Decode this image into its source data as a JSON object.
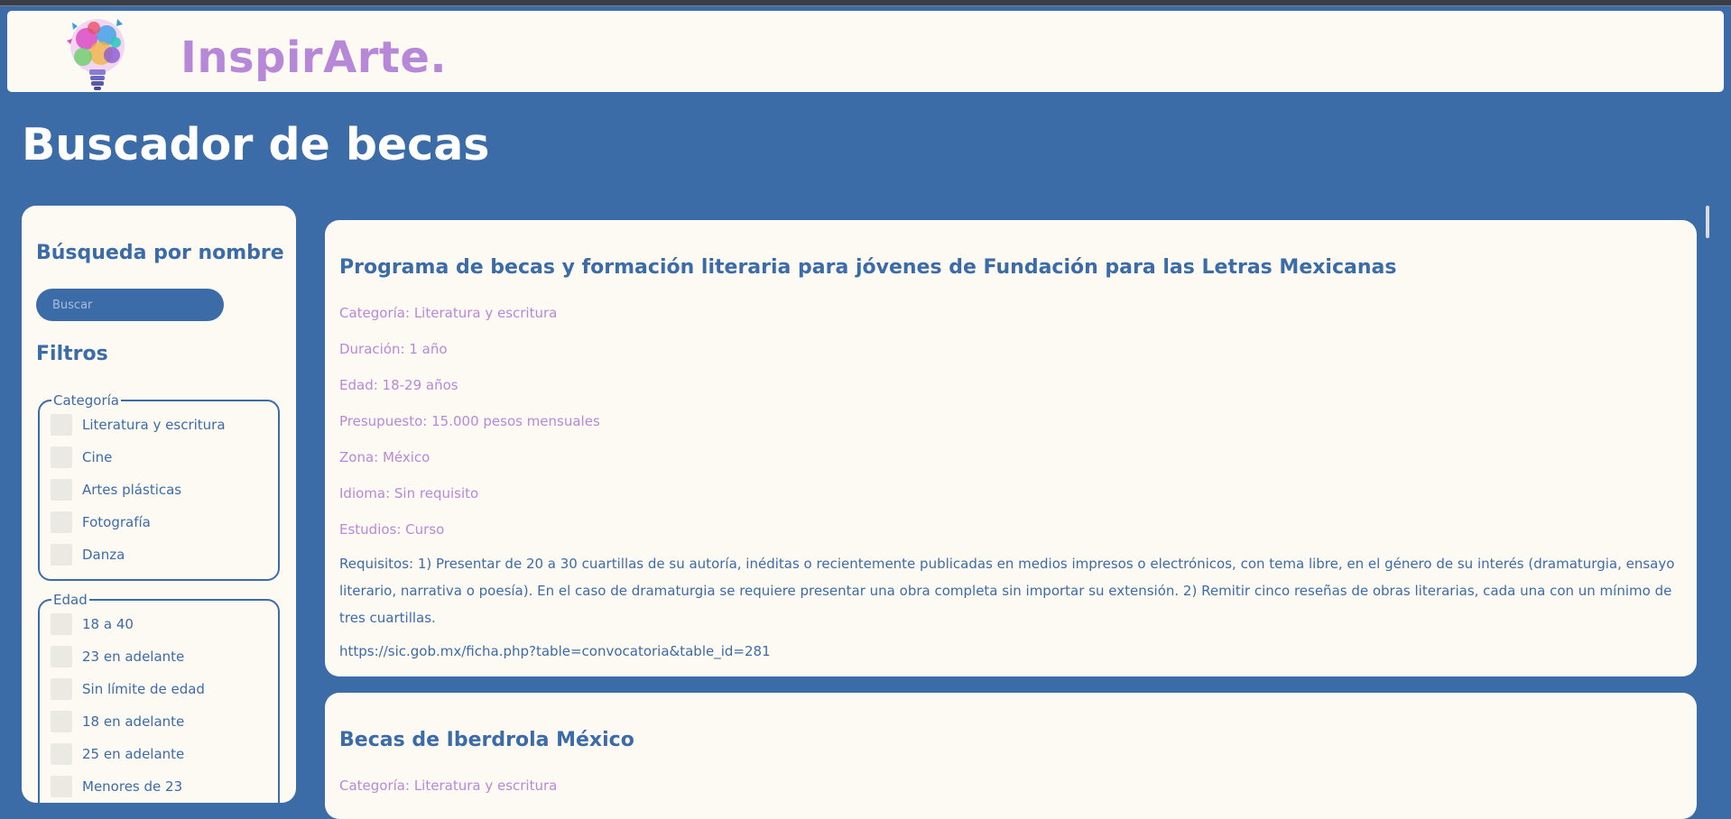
{
  "header": {
    "brand": "InspirArte."
  },
  "page": {
    "title": "Buscador de becas"
  },
  "sidebar": {
    "search_heading": "Búsqueda por nombre",
    "search_placeholder": "Buscar",
    "search_value": "",
    "filters_heading": "Filtros",
    "filters": [
      {
        "legend": "Categoría",
        "options": [
          "Literatura y escritura",
          "Cine",
          "Artes plásticas",
          "Fotografía",
          "Danza"
        ]
      },
      {
        "legend": "Edad",
        "options": [
          "18 a 40",
          "23 en adelante",
          "Sin límite de edad",
          "18 en adelante",
          "25 en adelante",
          "Menores de 23"
        ]
      }
    ]
  },
  "results": [
    {
      "title": "Programa de becas y formación literaria para jóvenes de Fundación para las Letras Mexicanas",
      "categoria": "Categoría: Literatura y escritura",
      "duracion": "Duración: 1 año",
      "edad": "Edad: 18-29 años",
      "presupuesto": "Presupuesto: 15.000 pesos mensuales",
      "zona": "Zona: México",
      "idioma": "Idioma: Sin requisito",
      "estudios": "Estudios: Curso",
      "requisitos": "Requisitos: 1) Presentar de 20 a 30 cuartillas de su autoría, inéditas o recientemente publicadas en medios impresos o electrónicos, con tema libre, en el género de su interés (dramaturgia, ensayo literario, narrativa o poesía). En el caso de dramaturgia se requiere presentar una obra completa sin importar su extensión. 2) Remitir cinco reseñas de obras literarias, cada una con un mínimo de tres cuartillas.",
      "link": "https://sic.gob.mx/ficha.php?table=convocatoria&table_id=281"
    },
    {
      "title": "Becas de Iberdrola México",
      "categoria": "Categoría: Literatura y escritura"
    }
  ],
  "colors": {
    "background": "#3b6ca8",
    "panel": "#fdfaf4",
    "accent": "#b888d8",
    "text": "#3b6ca8"
  },
  "icons": {
    "logo": "colorful-lightbulb-logo"
  }
}
